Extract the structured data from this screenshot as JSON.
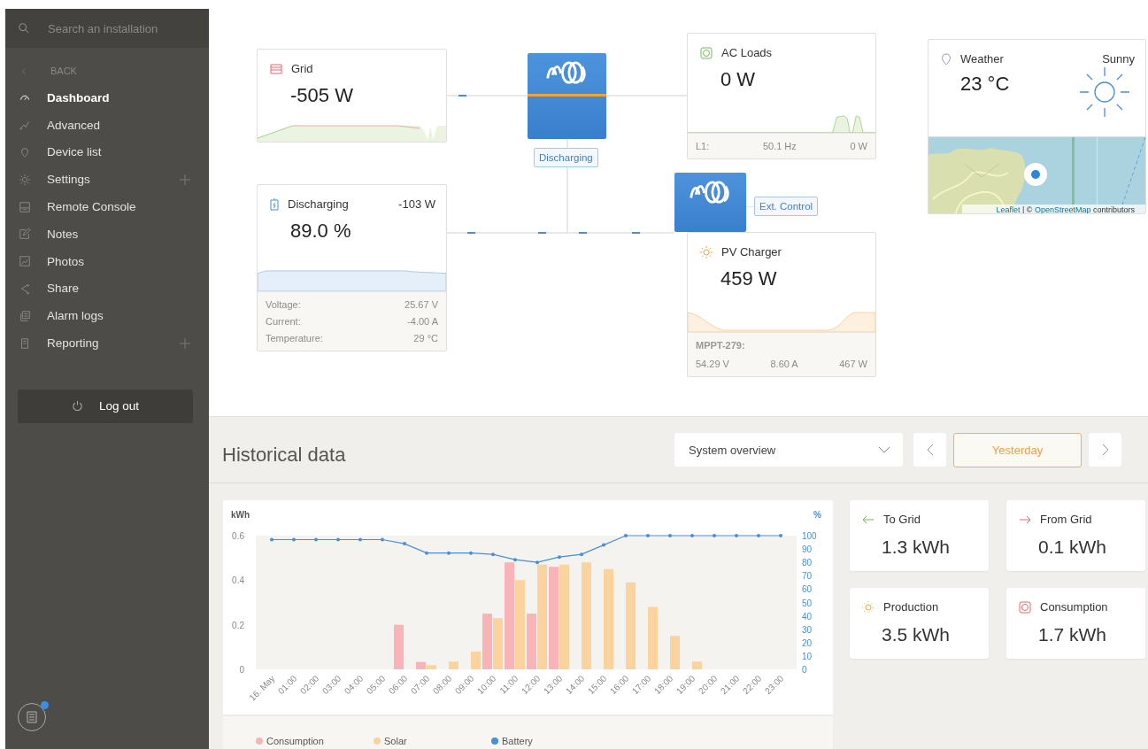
{
  "sidebar": {
    "search": {
      "placeholder": "Search an installation"
    },
    "back": "BACK",
    "items": [
      {
        "label": "Dashboard",
        "selected": true
      },
      {
        "label": "Advanced",
        "selected": false
      },
      {
        "label": "Device list",
        "selected": false
      },
      {
        "label": "Settings",
        "selected": false,
        "expanded": false
      },
      {
        "label": "Remote Console",
        "selected": false
      },
      {
        "label": "Notes",
        "selected": false
      },
      {
        "label": "Photos",
        "selected": false
      },
      {
        "label": "Share",
        "selected": false
      },
      {
        "label": "Alarm logs",
        "selected": false
      },
      {
        "label": "Reporting",
        "selected": false,
        "expanded": false
      }
    ],
    "logout": "Log out",
    "notes_unread": true
  },
  "diagram": {
    "grid": {
      "title": "Grid",
      "value": "-505 W"
    },
    "inverter": {
      "status": "Discharging"
    },
    "ac_loads": {
      "title": "AC Loads",
      "value": "0 W",
      "footer": [
        "L1:",
        "50.1 Hz",
        "0 W"
      ]
    },
    "battery": {
      "title": "Discharging",
      "power": "-103 W",
      "value": "89.0 %",
      "details": [
        {
          "label": "Voltage:",
          "value": "25.67 V"
        },
        {
          "label": "Current:",
          "value": "-4.00 A"
        },
        {
          "label": "Temperature:",
          "value": "29 °C"
        }
      ]
    },
    "charger": {
      "status": "Ext. Control"
    },
    "pv_charger": {
      "title": "PV Charger",
      "value": "459 W",
      "device": "MPPT-279:",
      "readings": [
        "54.29 V",
        "8.60 A",
        "467 W"
      ]
    }
  },
  "weather": {
    "title": "Weather",
    "condition": "Sunny",
    "temperature": "23 °C",
    "attribution": [
      {
        "text": "Leaflet",
        "link": true
      },
      {
        "text": " | © ",
        "link": false
      },
      {
        "text": "OpenStreetMap",
        "link": true
      },
      {
        "text": " contributors",
        "link": false
      }
    ]
  },
  "historical": {
    "title": "Historical data",
    "view": "System overview",
    "period": "Yesterday",
    "chart_data": {
      "type": "bar",
      "legend": "bottom",
      "ylabel": "kWh",
      "y2label": "%",
      "ylim": [
        0,
        0.6
      ],
      "yticks": [
        0,
        0.2,
        0.4,
        0.6
      ],
      "y2lim": [
        0,
        100
      ],
      "y2ticks": [
        0,
        10,
        20,
        30,
        40,
        50,
        60,
        70,
        80,
        90,
        100
      ],
      "categories": [
        "16. May",
        "01:00",
        "02:00",
        "03:00",
        "04:00",
        "05:00",
        "06:00",
        "07:00",
        "08:00",
        "09:00",
        "10:00",
        "11:00",
        "12:00",
        "13:00",
        "14:00",
        "15:00",
        "16:00",
        "17:00",
        "18:00",
        "19:00",
        "20:00",
        "21:00",
        "22:00",
        "23:00"
      ],
      "series": [
        {
          "name": "Consumption",
          "color": "#f8b4b7",
          "values": [
            null,
            null,
            null,
            null,
            null,
            null,
            0.2,
            0.033,
            null,
            null,
            0.25,
            0.48,
            0.25,
            0.46,
            null,
            null,
            null,
            null,
            null,
            null,
            null,
            null,
            null,
            null
          ]
        },
        {
          "name": "Solar",
          "color": "#fad39e",
          "values": [
            null,
            null,
            null,
            null,
            null,
            null,
            null,
            0.018,
            0.035,
            0.08,
            0.23,
            0.4,
            0.47,
            0.47,
            0.48,
            0.45,
            0.39,
            0.28,
            0.15,
            0.035,
            null,
            null,
            null,
            null
          ]
        },
        {
          "name": "Battery",
          "color": "#4a8fd6",
          "type": "line",
          "axis": "y2",
          "values": [
            97,
            97,
            97,
            97,
            97,
            97,
            94,
            87,
            87,
            87,
            86,
            82,
            80,
            84,
            86,
            93,
            100,
            100,
            100,
            100,
            100,
            100,
            100,
            100
          ]
        }
      ]
    },
    "summary": [
      {
        "kind": "to_grid",
        "label": "To Grid",
        "value": "1.3 kWh"
      },
      {
        "kind": "from_grid",
        "label": "From Grid",
        "value": "0.1 kWh"
      },
      {
        "kind": "production",
        "label": "Production",
        "value": "3.5 kWh"
      },
      {
        "kind": "consumption",
        "label": "Consumption",
        "value": "1.7 kWh"
      }
    ]
  }
}
